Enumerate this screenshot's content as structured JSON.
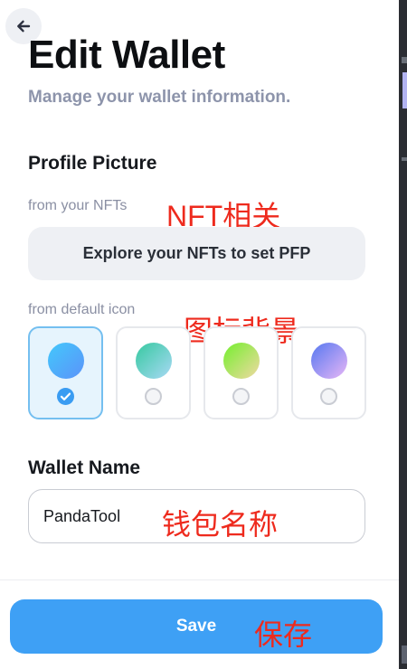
{
  "header": {
    "title": "Edit Wallet",
    "subtitle": "Manage your wallet information."
  },
  "profile_picture": {
    "section_title": "Profile Picture",
    "nft_hint": "from your NFTs",
    "nft_button_label": "Explore your NFTs to set PFP",
    "default_hint": "from default icon",
    "icons": [
      {
        "name": "blue",
        "selected": true,
        "gradient": [
          "#43c8fb",
          "#5b93fa"
        ]
      },
      {
        "name": "teal",
        "selected": false,
        "gradient": [
          "#36c9a0",
          "#a9d9f5"
        ]
      },
      {
        "name": "lime",
        "selected": false,
        "gradient": [
          "#74ef2e",
          "#f0d9a3"
        ]
      },
      {
        "name": "violet",
        "selected": false,
        "gradient": [
          "#5678f0",
          "#e8b6f6"
        ]
      }
    ]
  },
  "wallet_name": {
    "section_title": "Wallet Name",
    "value": "PandaTool"
  },
  "save_label": "Save",
  "annotations": {
    "nft": "NFT相关",
    "icon_bg": "图标背景",
    "wallet_name": "钱包名称",
    "save": "保存"
  },
  "colors": {
    "accent": "#3ea0f5",
    "annotation": "#ee2a1d",
    "selected_border": "#74bff0",
    "muted_text": "#8d94ab"
  }
}
